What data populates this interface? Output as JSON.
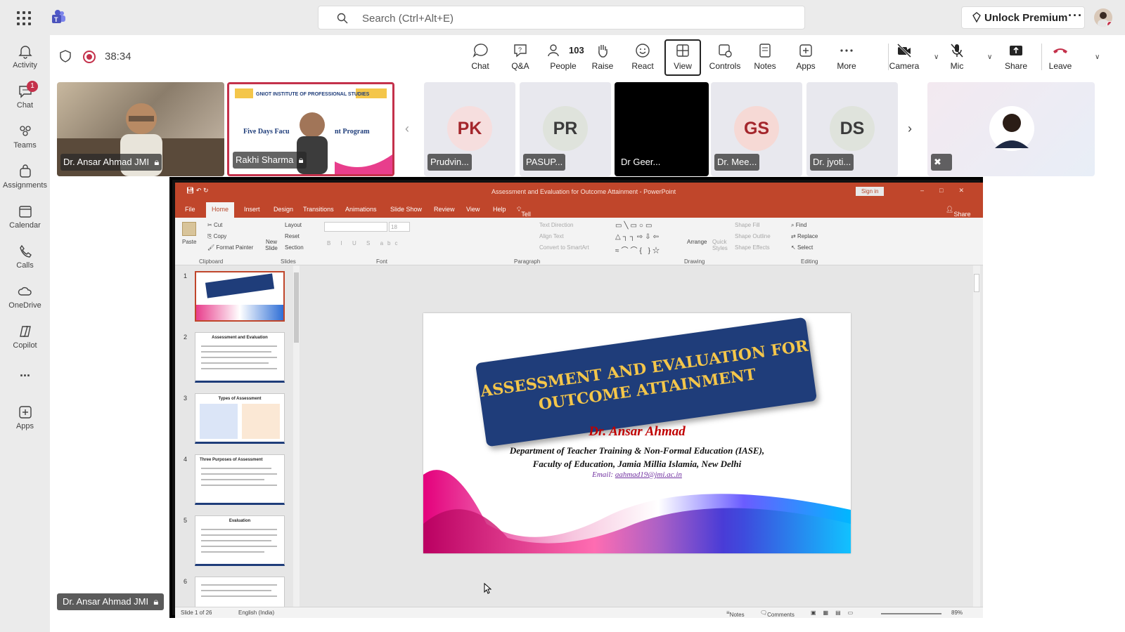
{
  "app": {
    "search_placeholder": "Search (Ctrl+Alt+E)",
    "premium_label": "Unlock Premium"
  },
  "rail": [
    {
      "label": "Activity",
      "icon": "bell-icon"
    },
    {
      "label": "Chat",
      "icon": "chat-icon",
      "badge": "1"
    },
    {
      "label": "Teams",
      "icon": "teams-icon"
    },
    {
      "label": "Assignments",
      "icon": "assignments-icon"
    },
    {
      "label": "Calendar",
      "icon": "calendar-icon"
    },
    {
      "label": "Calls",
      "icon": "phone-icon"
    },
    {
      "label": "OneDrive",
      "icon": "cloud-icon"
    },
    {
      "label": "Copilot",
      "icon": "copilot-icon"
    },
    {
      "label": "...",
      "icon": "more-icon"
    },
    {
      "label": "Apps",
      "icon": "add-apps-icon"
    }
  ],
  "meeting": {
    "timer": "38:34",
    "controls": {
      "chat": "Chat",
      "qa": "Q&A",
      "people": "People",
      "people_count": "103",
      "raise": "Raise",
      "react": "React",
      "view": "View",
      "controls": "Controls",
      "notes": "Notes",
      "apps": "Apps",
      "more": "More",
      "camera": "Camera",
      "mic": "Mic",
      "share": "Share",
      "leave": "Leave"
    },
    "participants": [
      {
        "name": "Dr. Ansar Ahmad JMI"
      },
      {
        "name": "Rakhi Sharma"
      },
      {
        "name": "Prudvin...",
        "initials": "PK",
        "color": "#f6dede",
        "text_color": "#a4262c"
      },
      {
        "name": "PASUP...",
        "initials": "PR",
        "color": "#dfe3dc",
        "text_color": "#3b3b3b"
      },
      {
        "name": "Dr Geer..."
      },
      {
        "name": "Dr. Mee...",
        "initials": "GS",
        "color": "#f6d9d5",
        "text_color": "#a4262c"
      },
      {
        "name": "Dr. jyoti...",
        "initials": "DS",
        "color": "#dfe3dc",
        "text_color": "#3b3b3b"
      }
    ],
    "presenter_label": "Dr. Ansar Ahmad JMI"
  },
  "powerpoint": {
    "title": "Assessment and Evaluation for Outcome Attainment - PowerPoint",
    "sign_in": "Sign in",
    "tabs": [
      "File",
      "Home",
      "Insert",
      "Design",
      "Transitions",
      "Animations",
      "Slide Show",
      "Review",
      "View",
      "Help"
    ],
    "tell_me": "Tell me what you want to do",
    "share": "Share",
    "ribbon": {
      "paste": "Paste",
      "cut": "Cut",
      "copy": "Copy",
      "format_painter": "Format Painter",
      "new_slide": "New Slide",
      "layout": "Layout",
      "reset": "Reset",
      "section": "Section",
      "font_size": "18",
      "text_direction": "Text Direction",
      "align_text": "Align Text",
      "convert_smartart": "Convert to SmartArt",
      "arrange": "Arrange",
      "quick_styles": "Quick Styles",
      "shape_fill": "Shape Fill",
      "shape_outline": "Shape Outline",
      "shape_effects": "Shape Effects",
      "find": "Find",
      "replace": "Replace",
      "select": "Select",
      "groups": [
        "Clipboard",
        "Slides",
        "Font",
        "Paragraph",
        "Drawing",
        "Editing"
      ]
    },
    "thumbnails": [
      {
        "num": "1"
      },
      {
        "num": "2",
        "title": "Assessment and Evaluation"
      },
      {
        "num": "3",
        "title": "Types of Assessment"
      },
      {
        "num": "4",
        "title": "Three Purposes of Assessment"
      },
      {
        "num": "5",
        "title": "Evaluation"
      },
      {
        "num": "6"
      }
    ],
    "slide": {
      "banner_line1": "ASSESSMENT AND EVALUATION FOR",
      "banner_line2": "OUTCOME ATTAINMENT",
      "author": "Dr.  Ansar Ahmad",
      "dept_line1": "Department of Teacher Training & Non-Formal Education (IASE),",
      "dept_line2": "Faculty of Education, Jamia Millia Islamia, New Delhi",
      "email_label": "Email:",
      "email": "aahmad19@jmi.ac.in"
    },
    "status": {
      "slide_count": "Slide 1 of 26",
      "language": "English (India)",
      "notes": "Notes",
      "comments": "Comments",
      "zoom": "89%"
    }
  }
}
